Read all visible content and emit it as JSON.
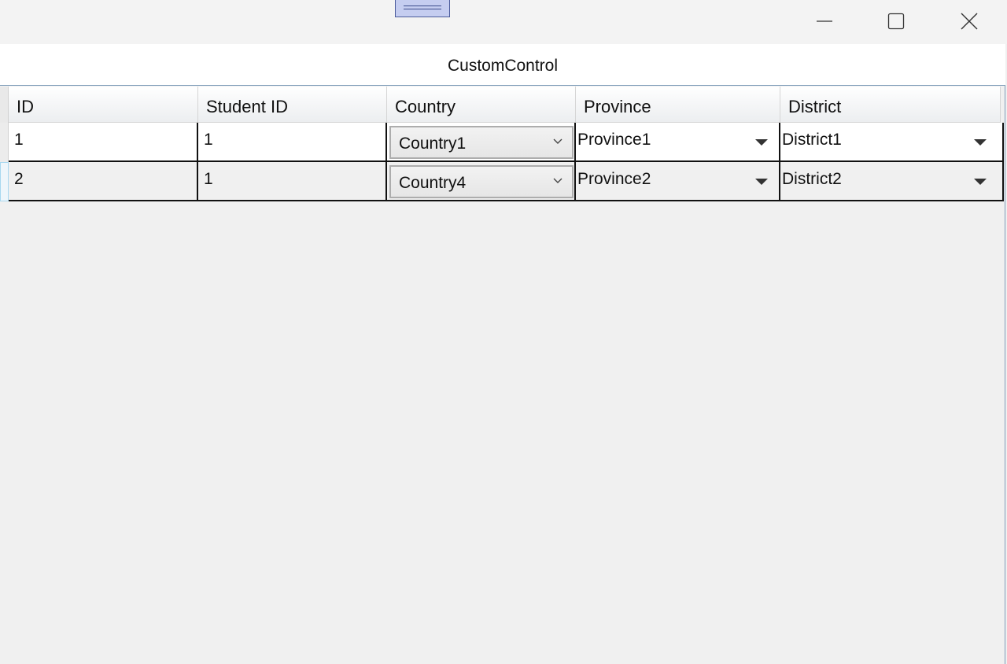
{
  "window": {
    "title": "CustomControl"
  },
  "grid": {
    "columns": [
      {
        "key": "id",
        "label": "ID"
      },
      {
        "key": "student_id",
        "label": "Student ID"
      },
      {
        "key": "country",
        "label": "Country"
      },
      {
        "key": "province",
        "label": "Province"
      },
      {
        "key": "district",
        "label": "District"
      }
    ],
    "rows": [
      {
        "id": "1",
        "student_id": "1",
        "country": "Country1",
        "province": "Province1",
        "district": "District1"
      },
      {
        "id": "2",
        "student_id": "1",
        "country": "Country4",
        "province": "Province2",
        "district": "District2"
      }
    ]
  },
  "icons": {
    "minimize": "minimize-icon",
    "maximize": "maximize-icon",
    "close": "close-icon",
    "combo_chevron": "chevron-down-icon",
    "dropdown_arrow": "caret-down-icon"
  },
  "colors": {
    "grip_fill": "#c5cdf0",
    "grid_line": "#111111",
    "border_accent": "#7f9db9"
  }
}
